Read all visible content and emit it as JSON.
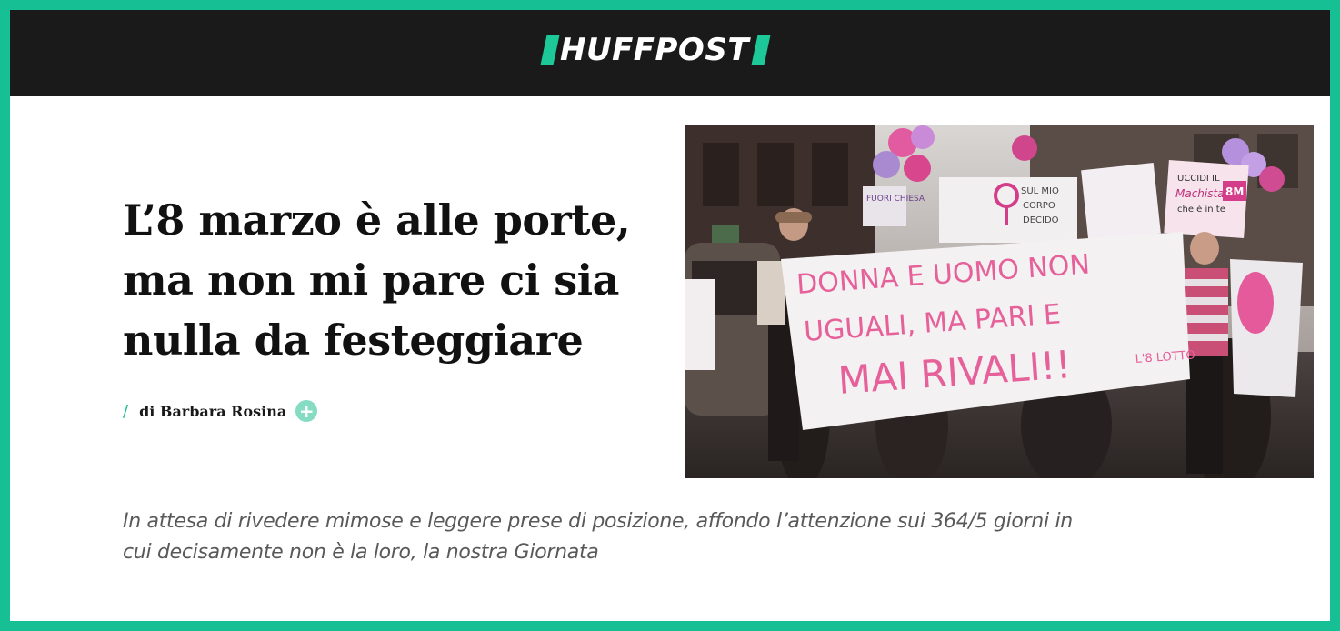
{
  "header": {
    "logo_text": "HUFFPOST",
    "brand_color": "#17bf94",
    "bar_color": "#1a1a1a"
  },
  "article": {
    "title": "L’8 marzo è alle porte, ma non mi pare ci sia nulla da festeggiare",
    "byline": {
      "separator": "/",
      "author": "di Barbara Rosina",
      "follow_icon": "plus-icon",
      "follow_symbol": "+"
    },
    "image": {
      "banner_lines": [
        "DONNA E UOMO NON",
        "UGUALI, MA PARI E",
        "MAI RIVALI!!"
      ],
      "banner_tag": "L'8 LOTTO",
      "sign_left": "FUORI CHIESA",
      "sign_center": [
        "SUL MIO",
        "CORPO",
        "DECIDO"
      ],
      "sign_right": [
        "UCCIDI IL",
        "Machista",
        "che è in te"
      ],
      "sign_right_tag": "8M"
    },
    "subtitle": "In attesa di rivedere mimose e leggere prese di posizione, affondo l’attenzione sui 364/5 giorni in cui decisamente non è la loro, la nostra Giornata"
  }
}
